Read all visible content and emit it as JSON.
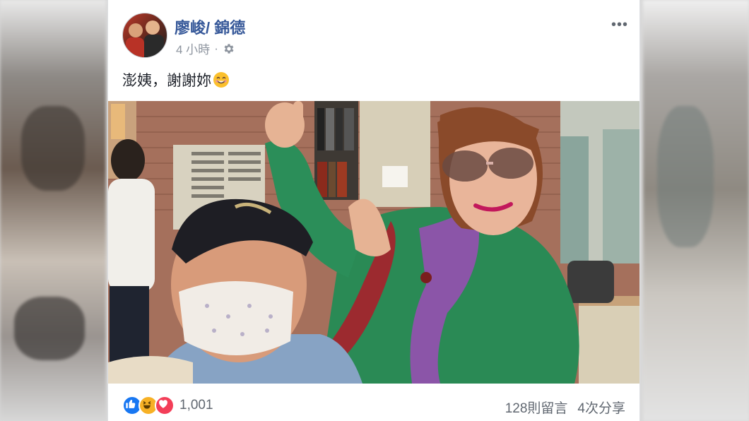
{
  "post": {
    "author": "廖峻/ 錦德",
    "time": "4 小時",
    "separator": "·",
    "caption": "澎姨，謝謝妳",
    "caption_emoji": "smiling-face-emoji"
  },
  "footer": {
    "reaction_icons": [
      "like-icon",
      "haha-icon",
      "love-icon"
    ],
    "reaction_count": "1,001",
    "comments": "128則留言",
    "shares": "4次分享"
  },
  "colors": {
    "author_link": "#365899",
    "meta_text": "#8d949e",
    "like_blue": "#1877f2",
    "haha_yellow": "#f7b125",
    "love_red": "#f33e58"
  }
}
